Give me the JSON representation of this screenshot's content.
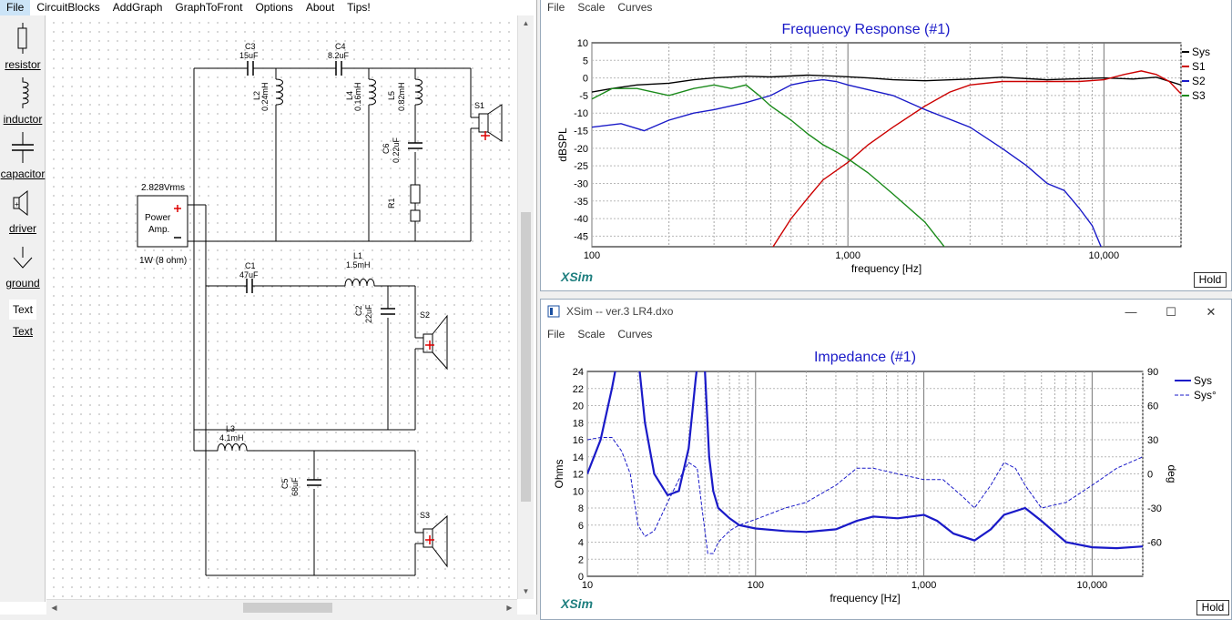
{
  "editor": {
    "menu": [
      "File",
      "CircuitBlocks",
      "AddGraph",
      "GraphToFront",
      "Options",
      "About",
      "Tips!"
    ],
    "palette": [
      {
        "label": "resistor",
        "icon": "resistor-icon"
      },
      {
        "label": "inductor",
        "icon": "inductor-icon"
      },
      {
        "label": "capacitor",
        "icon": "capacitor-icon"
      },
      {
        "label": "driver",
        "icon": "driver-icon"
      },
      {
        "label": "ground",
        "icon": "ground-icon"
      },
      {
        "label": "Text",
        "icon": "text-icon",
        "preview": "Text"
      }
    ],
    "schematic": {
      "amp": {
        "voltage": "2.828Vrms",
        "line1": "Power",
        "line2": "Amp.",
        "load": "1W (8 ohm)"
      },
      "components": [
        {
          "name": "C3",
          "value": "15uF"
        },
        {
          "name": "C4",
          "value": "8.2uF"
        },
        {
          "name": "L2",
          "value": "0.24mH"
        },
        {
          "name": "L4",
          "value": "0.16mH"
        },
        {
          "name": "L5",
          "value": "0.82mH"
        },
        {
          "name": "C6",
          "value": "0.22uF"
        },
        {
          "name": "R1",
          "value": ""
        },
        {
          "name": "S1",
          "value": ""
        },
        {
          "name": "C1",
          "value": "47uF"
        },
        {
          "name": "L1",
          "value": "1.5mH"
        },
        {
          "name": "C2",
          "value": "22uF"
        },
        {
          "name": "S2",
          "value": ""
        },
        {
          "name": "L3",
          "value": "4.1mH"
        },
        {
          "name": "C5",
          "value": "68uF"
        },
        {
          "name": "S3",
          "value": ""
        }
      ]
    }
  },
  "freq_window": {
    "menu": [
      "File",
      "Scale",
      "Curves"
    ],
    "brand": "XSim",
    "hold_label": "Hold",
    "colors": {
      "Sys": "#000000",
      "S1": "#cc0000",
      "S2": "#1a1ac8",
      "S3": "#1a8a1a"
    },
    "chart_data": {
      "type": "line",
      "title": "Frequency Response (#1)",
      "xlabel": "frequency [Hz]",
      "ylabel": "dBSPL",
      "x_scale": "log",
      "xlim": [
        100,
        20000
      ],
      "ylim": [
        -48,
        10
      ],
      "xticks": [
        {
          "v": 100,
          "label": "100"
        },
        {
          "v": 1000,
          "label": "1,000"
        },
        {
          "v": 10000,
          "label": "10,000"
        }
      ],
      "yticks": [
        10,
        5,
        0,
        -5,
        -10,
        -15,
        -20,
        -25,
        -30,
        -35,
        -40,
        -45
      ],
      "legend": "right",
      "grid": true,
      "series": [
        {
          "name": "Sys",
          "x": [
            100,
            120,
            150,
            200,
            250,
            300,
            400,
            500,
            700,
            900,
            1200,
            1500,
            2000,
            3000,
            4000,
            6000,
            8000,
            10000,
            13000,
            16000,
            20000
          ],
          "y": [
            -4,
            -3,
            -2,
            -1.5,
            -0.5,
            0,
            0.5,
            0.3,
            0.8,
            0.5,
            0,
            -0.5,
            -0.8,
            -0.3,
            0.2,
            -0.5,
            -0.2,
            0,
            -0.3,
            0.2,
            -2
          ]
        },
        {
          "name": "S1",
          "x": [
            500,
            600,
            700,
            800,
            1000,
            1200,
            1500,
            2000,
            2500,
            3000,
            4000,
            6000,
            8000,
            10000,
            12000,
            14000,
            16000,
            18000,
            20000
          ],
          "y": [
            -49,
            -40,
            -34,
            -29,
            -24,
            -19,
            -14,
            -8,
            -4,
            -2,
            -1,
            -1,
            -1,
            -0.5,
            1,
            2,
            1,
            -1,
            -4.5
          ]
        },
        {
          "name": "S2",
          "x": [
            100,
            130,
            160,
            200,
            250,
            300,
            400,
            500,
            600,
            700,
            800,
            900,
            1000,
            1500,
            2000,
            3000,
            4000,
            5000,
            6000,
            7000,
            8000,
            9000,
            10000
          ],
          "y": [
            -14,
            -13,
            -15,
            -12,
            -10,
            -9,
            -7,
            -5,
            -2,
            -1,
            -0.5,
            -1,
            -2,
            -5,
            -9,
            -14,
            -20,
            -25,
            -30,
            -32,
            -37,
            -42,
            -50
          ]
        },
        {
          "name": "S3",
          "x": [
            100,
            120,
            150,
            200,
            250,
            300,
            350,
            400,
            450,
            500,
            600,
            700,
            800,
            900,
            1000,
            1200,
            1500,
            2000,
            2500
          ],
          "y": [
            -6,
            -3,
            -3,
            -5,
            -3,
            -2,
            -3,
            -2,
            -5,
            -8,
            -12,
            -16,
            -19,
            -21,
            -23,
            -27,
            -33,
            -41,
            -50
          ]
        }
      ]
    }
  },
  "imp_window": {
    "title": "XSim -- ver.3 LR4.dxo",
    "menu": [
      "File",
      "Scale",
      "Curves"
    ],
    "brand": "XSim",
    "hold_label": "Hold",
    "colors": {
      "Sys": "#1a1ac8",
      "Sys°": "#1a1ac8"
    },
    "chart_data": {
      "type": "line",
      "title": "Impedance (#1)",
      "xlabel": "frequency [Hz]",
      "ylabel": "Ohms",
      "y2label": "deg",
      "x_scale": "log",
      "xlim": [
        10,
        20000
      ],
      "ylim": [
        0,
        24
      ],
      "y2lim": [
        -90,
        90
      ],
      "xticks": [
        {
          "v": 10,
          "label": "10"
        },
        {
          "v": 100,
          "label": "100"
        },
        {
          "v": 1000,
          "label": "1,000"
        },
        {
          "v": 10000,
          "label": "10,000"
        }
      ],
      "yticks": [
        24,
        22,
        20,
        18,
        16,
        14,
        12,
        10,
        8,
        6,
        4,
        2,
        0
      ],
      "y2ticks": [
        90,
        60,
        30,
        0,
        -30,
        -60
      ],
      "legend": "right",
      "grid": true,
      "series": [
        {
          "name": "Sys",
          "axis": "left",
          "style": "solid",
          "x": [
            10,
            12,
            14,
            16,
            18,
            20,
            22,
            25,
            30,
            35,
            40,
            44,
            47,
            50,
            53,
            56,
            60,
            70,
            80,
            100,
            150,
            200,
            300,
            400,
            500,
            700,
            1000,
            1200,
            1500,
            2000,
            2500,
            3000,
            4000,
            5000,
            7000,
            10000,
            14000,
            20000
          ],
          "y": [
            12,
            16,
            22,
            28,
            30,
            26,
            18,
            12,
            9.5,
            10,
            15,
            23,
            28,
            24,
            14,
            10,
            8,
            6.8,
            6,
            5.6,
            5.3,
            5.2,
            5.5,
            6.5,
            7,
            6.8,
            7.2,
            6.5,
            5,
            4.2,
            5.5,
            7.2,
            8,
            6.5,
            4,
            3.4,
            3.3,
            3.5
          ]
        },
        {
          "name": "Sys°",
          "axis": "right",
          "style": "dashed",
          "x": [
            10,
            12,
            14,
            16,
            18,
            20,
            22,
            25,
            30,
            35,
            40,
            45,
            48,
            52,
            56,
            60,
            70,
            80,
            100,
            150,
            200,
            300,
            400,
            500,
            700,
            1000,
            1300,
            1700,
            2000,
            2500,
            3000,
            3500,
            4000,
            5000,
            7000,
            10000,
            14000,
            20000
          ],
          "y": [
            30,
            32,
            32,
            20,
            0,
            -45,
            -55,
            -50,
            -25,
            -5,
            10,
            5,
            -30,
            -70,
            -70,
            -60,
            -50,
            -45,
            -40,
            -30,
            -25,
            -10,
            5,
            5,
            0,
            -5,
            -5,
            -20,
            -30,
            -10,
            10,
            5,
            -10,
            -30,
            -25,
            -10,
            5,
            15
          ]
        }
      ]
    }
  }
}
